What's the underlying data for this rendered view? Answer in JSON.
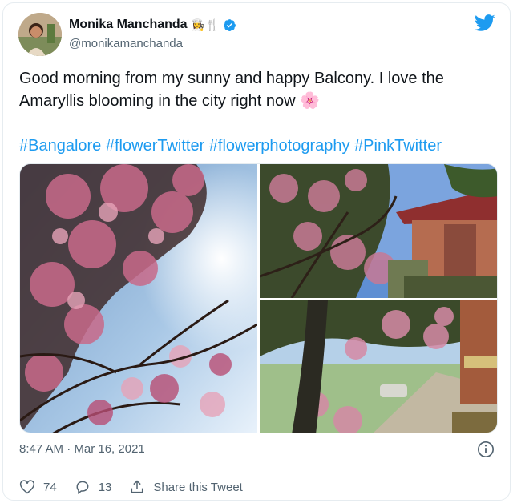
{
  "author": {
    "display_name": "Monika Manchanda",
    "name_emoji": "👩‍🍳🍴",
    "handle": "@monikamanchanda",
    "verified": true
  },
  "tweet": {
    "text": "Good morning from my sunny and happy Balcony. I love the Amaryllis blooming in the city right now 🌸",
    "hashtags": [
      "#Bangalore",
      "#flowerTwitter",
      "#flowerphotography",
      "#PinkTwitter"
    ]
  },
  "meta": {
    "timestamp": "8:47 AM · Mar 16, 2021"
  },
  "actions": {
    "likes": "74",
    "replies": "13",
    "share_label": "Share this Tweet"
  },
  "colors": {
    "link": "#1d9bf0",
    "text": "#0f1419",
    "muted": "#536471",
    "verified": "#1d9bf0",
    "brand": "#1d9bf0"
  },
  "icons": [
    "verified-badge-icon",
    "twitter-bird-icon",
    "info-icon",
    "heart-icon",
    "reply-icon",
    "share-icon"
  ]
}
